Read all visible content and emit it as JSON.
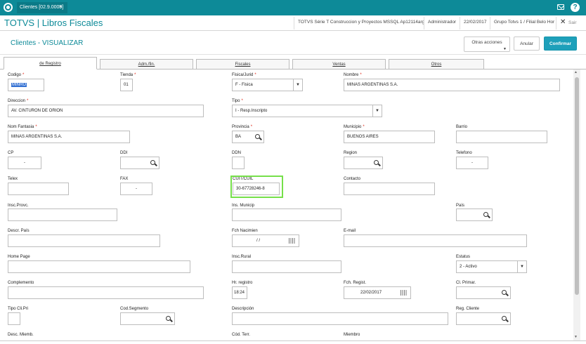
{
  "titlebar": {
    "tab_label": "Clientes [02.9.0009]",
    "tab_close": "×",
    "help": "?"
  },
  "header": {
    "app_title": "TOTVS | Libros Fiscales",
    "company": "TOTVS Série T Construccion y Proyectos MSSQL Ap12114arg",
    "user": "Administrador",
    "date": "22/02/2017",
    "branch": "Grupo Totvs 1 / Filial Belo Hor",
    "close_label": "Sair",
    "close_x": "✕"
  },
  "page": {
    "title": "Clientes - VISUALIZAR"
  },
  "toolbar": {
    "otras_acciones": "Otras acciones",
    "anular": "Anular",
    "confirmar": "Confirmar",
    "otras_arrow": "▼"
  },
  "tabs": [
    "de Registro",
    "Adm./fin.",
    "Fiscales",
    "Ventas",
    "Otros"
  ],
  "fields": {
    "codigo": {
      "label": "Codigo",
      "value": "MINRO"
    },
    "tienda": {
      "label": "Tienda",
      "value": "01"
    },
    "fisica_jurid": {
      "label": "Fisica/Jurid",
      "value": "F - Fisica"
    },
    "nombre": {
      "label": "Nombre",
      "value": "MINAS ARGENTINAS S.A."
    },
    "direccion": {
      "label": "Direccion",
      "value": "AV. CINTURON DE ORION"
    },
    "tipo": {
      "label": "Tipo",
      "value": "I - Resp.Inscripto"
    },
    "nom_fantasia": {
      "label": "Nom Fantasia",
      "value": "MINAS ARGENTINAS S.A."
    },
    "provincia": {
      "label": "Provincia",
      "value": "BA"
    },
    "municipio": {
      "label": "Municipio",
      "value": "BUENOS AIRES"
    },
    "barrio": {
      "label": "Barrio",
      "value": ""
    },
    "cp": {
      "label": "CP",
      "value": "-"
    },
    "ddi": {
      "label": "DDI",
      "value": ""
    },
    "ddn": {
      "label": "DDN",
      "value": ""
    },
    "region": {
      "label": "Region",
      "value": ""
    },
    "telefono": {
      "label": "Telefono",
      "value": "-"
    },
    "telex": {
      "label": "Telex",
      "value": ""
    },
    "fax": {
      "label": "FAX",
      "value": "-"
    },
    "cuit": {
      "label": "CUIT/CUIL",
      "value": "30-67728246-8"
    },
    "contacto": {
      "label": "Contacto",
      "value": ""
    },
    "insc_provc": {
      "label": "Insc.Provc.",
      "value": ""
    },
    "ins_municip": {
      "label": "Ins. Municip",
      "value": ""
    },
    "pais": {
      "label": "País",
      "value": ""
    },
    "descr_pais": {
      "label": "Descr. País",
      "value": ""
    },
    "fch_nacimien": {
      "label": "Fch Nacimien",
      "value": "/  /"
    },
    "email": {
      "label": "E-mail",
      "value": ""
    },
    "home_page": {
      "label": "Home Page",
      "value": ""
    },
    "insc_rural": {
      "label": "Insc.Rural",
      "value": ""
    },
    "estatus": {
      "label": "Estatus",
      "value": "2 - Activo"
    },
    "complemento": {
      "label": "Complemento",
      "value": ""
    },
    "hr_registro": {
      "label": "Hr. registro",
      "value": "18:24"
    },
    "fch_regist": {
      "label": "Fch. Regist.",
      "value": "22/02/2017"
    },
    "cli_primar": {
      "label": "Cl. Primar.",
      "value": ""
    },
    "tipo_clipri": {
      "label": "Tipo Cli.Pri",
      "value": ""
    },
    "cod_segmento": {
      "label": "Cod.Segmento",
      "value": ""
    },
    "descripcion": {
      "label": "Descripción",
      "value": ""
    },
    "reg_cliente": {
      "label": "Reg. Cliente",
      "value": ""
    },
    "desc_miemb": {
      "label": "Desc. Miemb.",
      "value": ""
    },
    "cod_terr": {
      "label": "Cód. Terr.",
      "value": ""
    },
    "miembro": {
      "label": "Miembro",
      "value": ""
    }
  },
  "required_mark": "*",
  "select_arrow": "▼",
  "scroll": {
    "up": "▲",
    "down": "▼"
  },
  "colors": {
    "accent": "#0d8a98",
    "primary_button": "#1ea0ba",
    "highlight": "#76e04a"
  }
}
